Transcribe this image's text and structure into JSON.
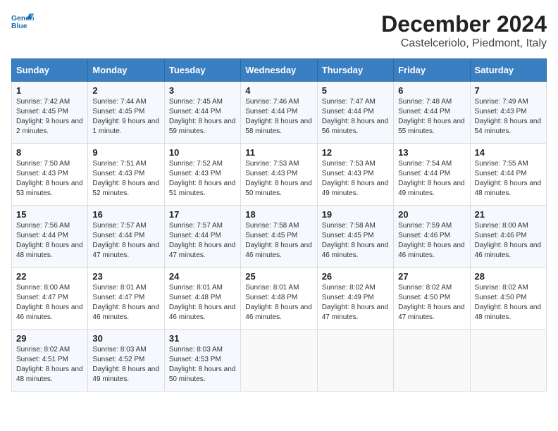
{
  "logo": {
    "line1": "General",
    "line2": "Blue"
  },
  "title": "December 2024",
  "location": "Castelceriolo, Piedmont, Italy",
  "days_of_week": [
    "Sunday",
    "Monday",
    "Tuesday",
    "Wednesday",
    "Thursday",
    "Friday",
    "Saturday"
  ],
  "weeks": [
    [
      {
        "day": "1",
        "sunrise": "Sunrise: 7:42 AM",
        "sunset": "Sunset: 4:45 PM",
        "daylight": "Daylight: 9 hours and 2 minutes."
      },
      {
        "day": "2",
        "sunrise": "Sunrise: 7:44 AM",
        "sunset": "Sunset: 4:45 PM",
        "daylight": "Daylight: 9 hours and 1 minute."
      },
      {
        "day": "3",
        "sunrise": "Sunrise: 7:45 AM",
        "sunset": "Sunset: 4:44 PM",
        "daylight": "Daylight: 8 hours and 59 minutes."
      },
      {
        "day": "4",
        "sunrise": "Sunrise: 7:46 AM",
        "sunset": "Sunset: 4:44 PM",
        "daylight": "Daylight: 8 hours and 58 minutes."
      },
      {
        "day": "5",
        "sunrise": "Sunrise: 7:47 AM",
        "sunset": "Sunset: 4:44 PM",
        "daylight": "Daylight: 8 hours and 56 minutes."
      },
      {
        "day": "6",
        "sunrise": "Sunrise: 7:48 AM",
        "sunset": "Sunset: 4:44 PM",
        "daylight": "Daylight: 8 hours and 55 minutes."
      },
      {
        "day": "7",
        "sunrise": "Sunrise: 7:49 AM",
        "sunset": "Sunset: 4:43 PM",
        "daylight": "Daylight: 8 hours and 54 minutes."
      }
    ],
    [
      {
        "day": "8",
        "sunrise": "Sunrise: 7:50 AM",
        "sunset": "Sunset: 4:43 PM",
        "daylight": "Daylight: 8 hours and 53 minutes."
      },
      {
        "day": "9",
        "sunrise": "Sunrise: 7:51 AM",
        "sunset": "Sunset: 4:43 PM",
        "daylight": "Daylight: 8 hours and 52 minutes."
      },
      {
        "day": "10",
        "sunrise": "Sunrise: 7:52 AM",
        "sunset": "Sunset: 4:43 PM",
        "daylight": "Daylight: 8 hours and 51 minutes."
      },
      {
        "day": "11",
        "sunrise": "Sunrise: 7:53 AM",
        "sunset": "Sunset: 4:43 PM",
        "daylight": "Daylight: 8 hours and 50 minutes."
      },
      {
        "day": "12",
        "sunrise": "Sunrise: 7:53 AM",
        "sunset": "Sunset: 4:43 PM",
        "daylight": "Daylight: 8 hours and 49 minutes."
      },
      {
        "day": "13",
        "sunrise": "Sunrise: 7:54 AM",
        "sunset": "Sunset: 4:44 PM",
        "daylight": "Daylight: 8 hours and 49 minutes."
      },
      {
        "day": "14",
        "sunrise": "Sunrise: 7:55 AM",
        "sunset": "Sunset: 4:44 PM",
        "daylight": "Daylight: 8 hours and 48 minutes."
      }
    ],
    [
      {
        "day": "15",
        "sunrise": "Sunrise: 7:56 AM",
        "sunset": "Sunset: 4:44 PM",
        "daylight": "Daylight: 8 hours and 48 minutes."
      },
      {
        "day": "16",
        "sunrise": "Sunrise: 7:57 AM",
        "sunset": "Sunset: 4:44 PM",
        "daylight": "Daylight: 8 hours and 47 minutes."
      },
      {
        "day": "17",
        "sunrise": "Sunrise: 7:57 AM",
        "sunset": "Sunset: 4:44 PM",
        "daylight": "Daylight: 8 hours and 47 minutes."
      },
      {
        "day": "18",
        "sunrise": "Sunrise: 7:58 AM",
        "sunset": "Sunset: 4:45 PM",
        "daylight": "Daylight: 8 hours and 46 minutes."
      },
      {
        "day": "19",
        "sunrise": "Sunrise: 7:58 AM",
        "sunset": "Sunset: 4:45 PM",
        "daylight": "Daylight: 8 hours and 46 minutes."
      },
      {
        "day": "20",
        "sunrise": "Sunrise: 7:59 AM",
        "sunset": "Sunset: 4:46 PM",
        "daylight": "Daylight: 8 hours and 46 minutes."
      },
      {
        "day": "21",
        "sunrise": "Sunrise: 8:00 AM",
        "sunset": "Sunset: 4:46 PM",
        "daylight": "Daylight: 8 hours and 46 minutes."
      }
    ],
    [
      {
        "day": "22",
        "sunrise": "Sunrise: 8:00 AM",
        "sunset": "Sunset: 4:47 PM",
        "daylight": "Daylight: 8 hours and 46 minutes."
      },
      {
        "day": "23",
        "sunrise": "Sunrise: 8:01 AM",
        "sunset": "Sunset: 4:47 PM",
        "daylight": "Daylight: 8 hours and 46 minutes."
      },
      {
        "day": "24",
        "sunrise": "Sunrise: 8:01 AM",
        "sunset": "Sunset: 4:48 PM",
        "daylight": "Daylight: 8 hours and 46 minutes."
      },
      {
        "day": "25",
        "sunrise": "Sunrise: 8:01 AM",
        "sunset": "Sunset: 4:48 PM",
        "daylight": "Daylight: 8 hours and 46 minutes."
      },
      {
        "day": "26",
        "sunrise": "Sunrise: 8:02 AM",
        "sunset": "Sunset: 4:49 PM",
        "daylight": "Daylight: 8 hours and 47 minutes."
      },
      {
        "day": "27",
        "sunrise": "Sunrise: 8:02 AM",
        "sunset": "Sunset: 4:50 PM",
        "daylight": "Daylight: 8 hours and 47 minutes."
      },
      {
        "day": "28",
        "sunrise": "Sunrise: 8:02 AM",
        "sunset": "Sunset: 4:50 PM",
        "daylight": "Daylight: 8 hours and 48 minutes."
      }
    ],
    [
      {
        "day": "29",
        "sunrise": "Sunrise: 8:02 AM",
        "sunset": "Sunset: 4:51 PM",
        "daylight": "Daylight: 8 hours and 48 minutes."
      },
      {
        "day": "30",
        "sunrise": "Sunrise: 8:03 AM",
        "sunset": "Sunset: 4:52 PM",
        "daylight": "Daylight: 8 hours and 49 minutes."
      },
      {
        "day": "31",
        "sunrise": "Sunrise: 8:03 AM",
        "sunset": "Sunset: 4:53 PM",
        "daylight": "Daylight: 8 hours and 50 minutes."
      },
      null,
      null,
      null,
      null
    ]
  ]
}
